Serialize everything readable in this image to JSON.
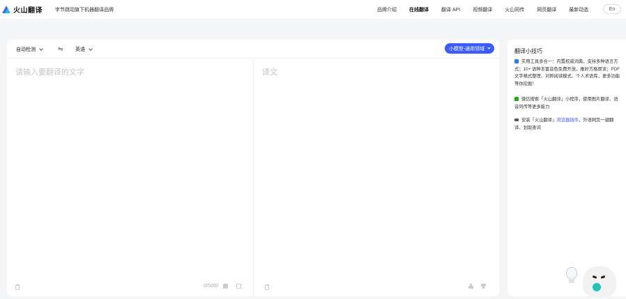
{
  "header": {
    "logo_text": "火山翻译",
    "slogan": "字节跳动旗下机器翻译品牌",
    "nav": [
      "品牌介绍",
      "在线翻译",
      "翻译 API",
      "视频翻译",
      "火山同传",
      "网页翻译",
      "最新动态"
    ],
    "active_nav": "在线翻译",
    "lang_button": "En"
  },
  "translator": {
    "source_lang": "自动检测",
    "swap_icon": "⇋",
    "target_lang": "英语",
    "model_button": "小模型-通用领域",
    "source_placeholder": "请输入要翻译的文字",
    "target_placeholder": "译文",
    "char_count": "0/5000"
  },
  "tips": {
    "title": "翻译小技巧",
    "items": [
      {
        "icon": "document-icon",
        "color": "#2d7be5",
        "text": "实用工具多合一：内置权威词典，支持多种语言方式；10+ 语种丰富音色免费开放，推好方格原读；PDF文字格式整理、对照阅读模式、个人术语库，更多功能等你挖掘！"
      },
      {
        "icon": "wechat-icon",
        "color": "#1aad19",
        "text": "微信搜索「火山翻译」小程序，使用图片翻译、语音同传等更多能力"
      },
      {
        "icon": "plugin-icon",
        "color": "#555555",
        "text_before": "安装「火山翻译」",
        "link": "浏览器插件",
        "text_after": "，外语网页一键翻译、划取查词"
      }
    ]
  }
}
